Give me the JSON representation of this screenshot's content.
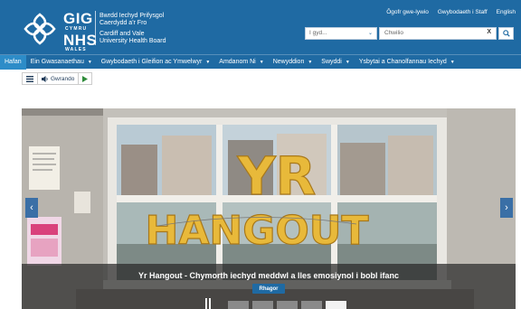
{
  "header": {
    "logo": {
      "gig": "GIG",
      "cymru": "CYMRU",
      "nhs": "NHS",
      "wales": "WALES"
    },
    "org_welsh_1": "Bwrdd Iechyd Prifysgol",
    "org_welsh_2": "Caerdydd a'r Fro",
    "org_english_1": "Cardiff and Vale",
    "org_english_2": "University Health Board",
    "top_links": [
      "Ōgofr gwe-lywio",
      "Gwybodaeth i Staff",
      "English"
    ],
    "select_value": "I gyd...",
    "search_placeholder": "Chwilio",
    "clear_label": "X"
  },
  "nav": {
    "items": [
      {
        "label": "Hafan",
        "dropdown": false
      },
      {
        "label": "Ein Gwasanaethau",
        "dropdown": true
      },
      {
        "label": "Gwybodaeth i Gleifion ac Ymwelwyr",
        "dropdown": true
      },
      {
        "label": "Amdanom Ni",
        "dropdown": true
      },
      {
        "label": "Newyddion",
        "dropdown": true
      },
      {
        "label": "Swyddi",
        "dropdown": true
      },
      {
        "label": "Ysbytai a Chanolfannau Iechyd",
        "dropdown": true
      }
    ],
    "caret": "▼"
  },
  "listen": {
    "label": "Gwrando"
  },
  "carousel": {
    "balloon_line1": "YR",
    "balloon_line2": "HANGOUT",
    "caption": "Yr Hangout - Chymorth iechyd meddwl a lles emosiynol i bobl ifanc",
    "more_button": "Rhagor",
    "prev_glyph": "‹",
    "next_glyph": "›",
    "slide_count": 5,
    "active_slide": 5
  },
  "colors": {
    "brand_blue": "#1f6aa3",
    "nav_active": "#2d8cc8",
    "balloon_gold": "#e8b93a"
  }
}
